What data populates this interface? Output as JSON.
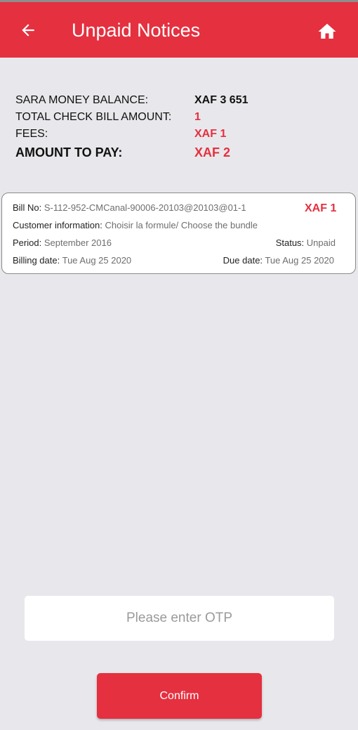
{
  "colors": {
    "accent": "#e5303f",
    "background": "#e8e8ec",
    "card": "#ffffff"
  },
  "header": {
    "title": "Unpaid Notices",
    "back_icon": "arrow-left-icon",
    "home_icon": "home-icon"
  },
  "summary": {
    "balance_label": "SARA MONEY BALANCE:",
    "balance_value": "XAF 3 651",
    "total_label": "TOTAL CHECK BILL AMOUNT:",
    "total_value": "1",
    "fees_label": "FEES:",
    "fees_value": "XAF 1",
    "pay_label": "AMOUNT TO PAY:",
    "pay_value": "XAF 2"
  },
  "bill": {
    "bill_no_label": "Bill No:",
    "bill_no_value": "S-112-952-CMCanal-90006-20103@20103@01-1",
    "amount": "XAF 1",
    "customer_label": "Customer information:",
    "customer_value": "Choisir la formule/ Choose the bundle",
    "period_label": "Period:",
    "period_value": "September 2016",
    "status_label": "Status:",
    "status_value": "Unpaid",
    "billing_label": "Billing date:",
    "billing_value": "Tue Aug 25 2020",
    "due_label": "Due date:",
    "due_value": "Tue Aug 25 2020"
  },
  "otp": {
    "placeholder": "Please enter OTP",
    "value": ""
  },
  "confirm_label": "Confirm"
}
